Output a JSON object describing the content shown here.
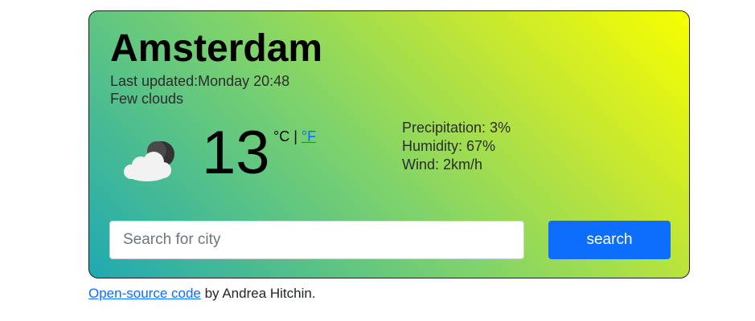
{
  "weather": {
    "city": "Amsterdam",
    "last_updated_label": "Last updated:",
    "last_updated_value": "Monday 20:48",
    "description": "Few clouds",
    "icon": "few-clouds-night-icon",
    "temperature": "13",
    "unit_celsius": "°C",
    "unit_separator": " | ",
    "unit_fahrenheit": "°F",
    "precipitation": "Precipitation: 3%",
    "humidity": "Humidity: 67%",
    "wind": "Wind: 2km/h"
  },
  "search": {
    "placeholder": "Search for city",
    "value": "",
    "button_label": "search"
  },
  "footer": {
    "link_text": "Open-source code",
    "suffix": " by Andrea Hitchin."
  },
  "colors": {
    "gradient_start": "#1fa9b2",
    "gradient_mid": "#7ed36b",
    "gradient_end": "#f7ff00",
    "button": "#0d6efd",
    "link": "#0d6efd"
  }
}
